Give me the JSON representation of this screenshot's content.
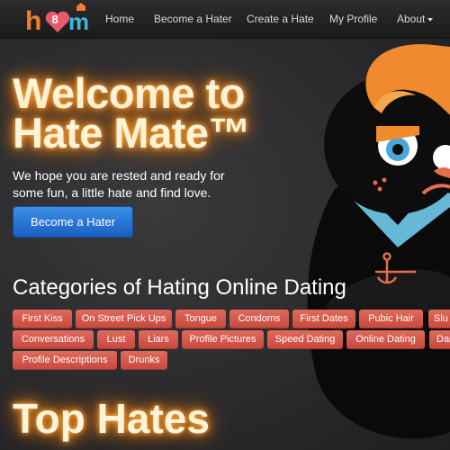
{
  "logo": {
    "text": "h8m"
  },
  "nav": {
    "items": [
      {
        "label": "Home"
      },
      {
        "label": "Become a Hater"
      },
      {
        "label": "Create a Hate"
      },
      {
        "label": "My Profile"
      },
      {
        "label": "About"
      }
    ]
  },
  "hero": {
    "title_line1": "Welcome to",
    "title_line2": "Hate Mate™",
    "tagline": "We hope you are rested and ready for some fun, a little hate and find love.",
    "cta_label": "Become a Hater"
  },
  "categories": {
    "heading": "Categories of Hating Online Dating",
    "tags": [
      "First Kiss",
      "On Street Pick Ups",
      "Tongue",
      "Condoms",
      "First Dates",
      "Pubic Hair",
      "Slu",
      "Conversations",
      "Lust",
      "Liars",
      "Profile Pictures",
      "Speed Dating",
      "Online Dating",
      "Dar",
      "Profile Descriptions",
      "Drunks"
    ]
  },
  "top_hates": {
    "heading": "Top Hates"
  },
  "colors": {
    "accent_button": "#2a7ad6",
    "tag": "#d65a4e",
    "glow": "#ff8a1a",
    "navbar": "#222222"
  },
  "icons": [
    "logo-heart-icon",
    "caret-down-icon",
    "anchor-icon",
    "mascot-illustration"
  ]
}
